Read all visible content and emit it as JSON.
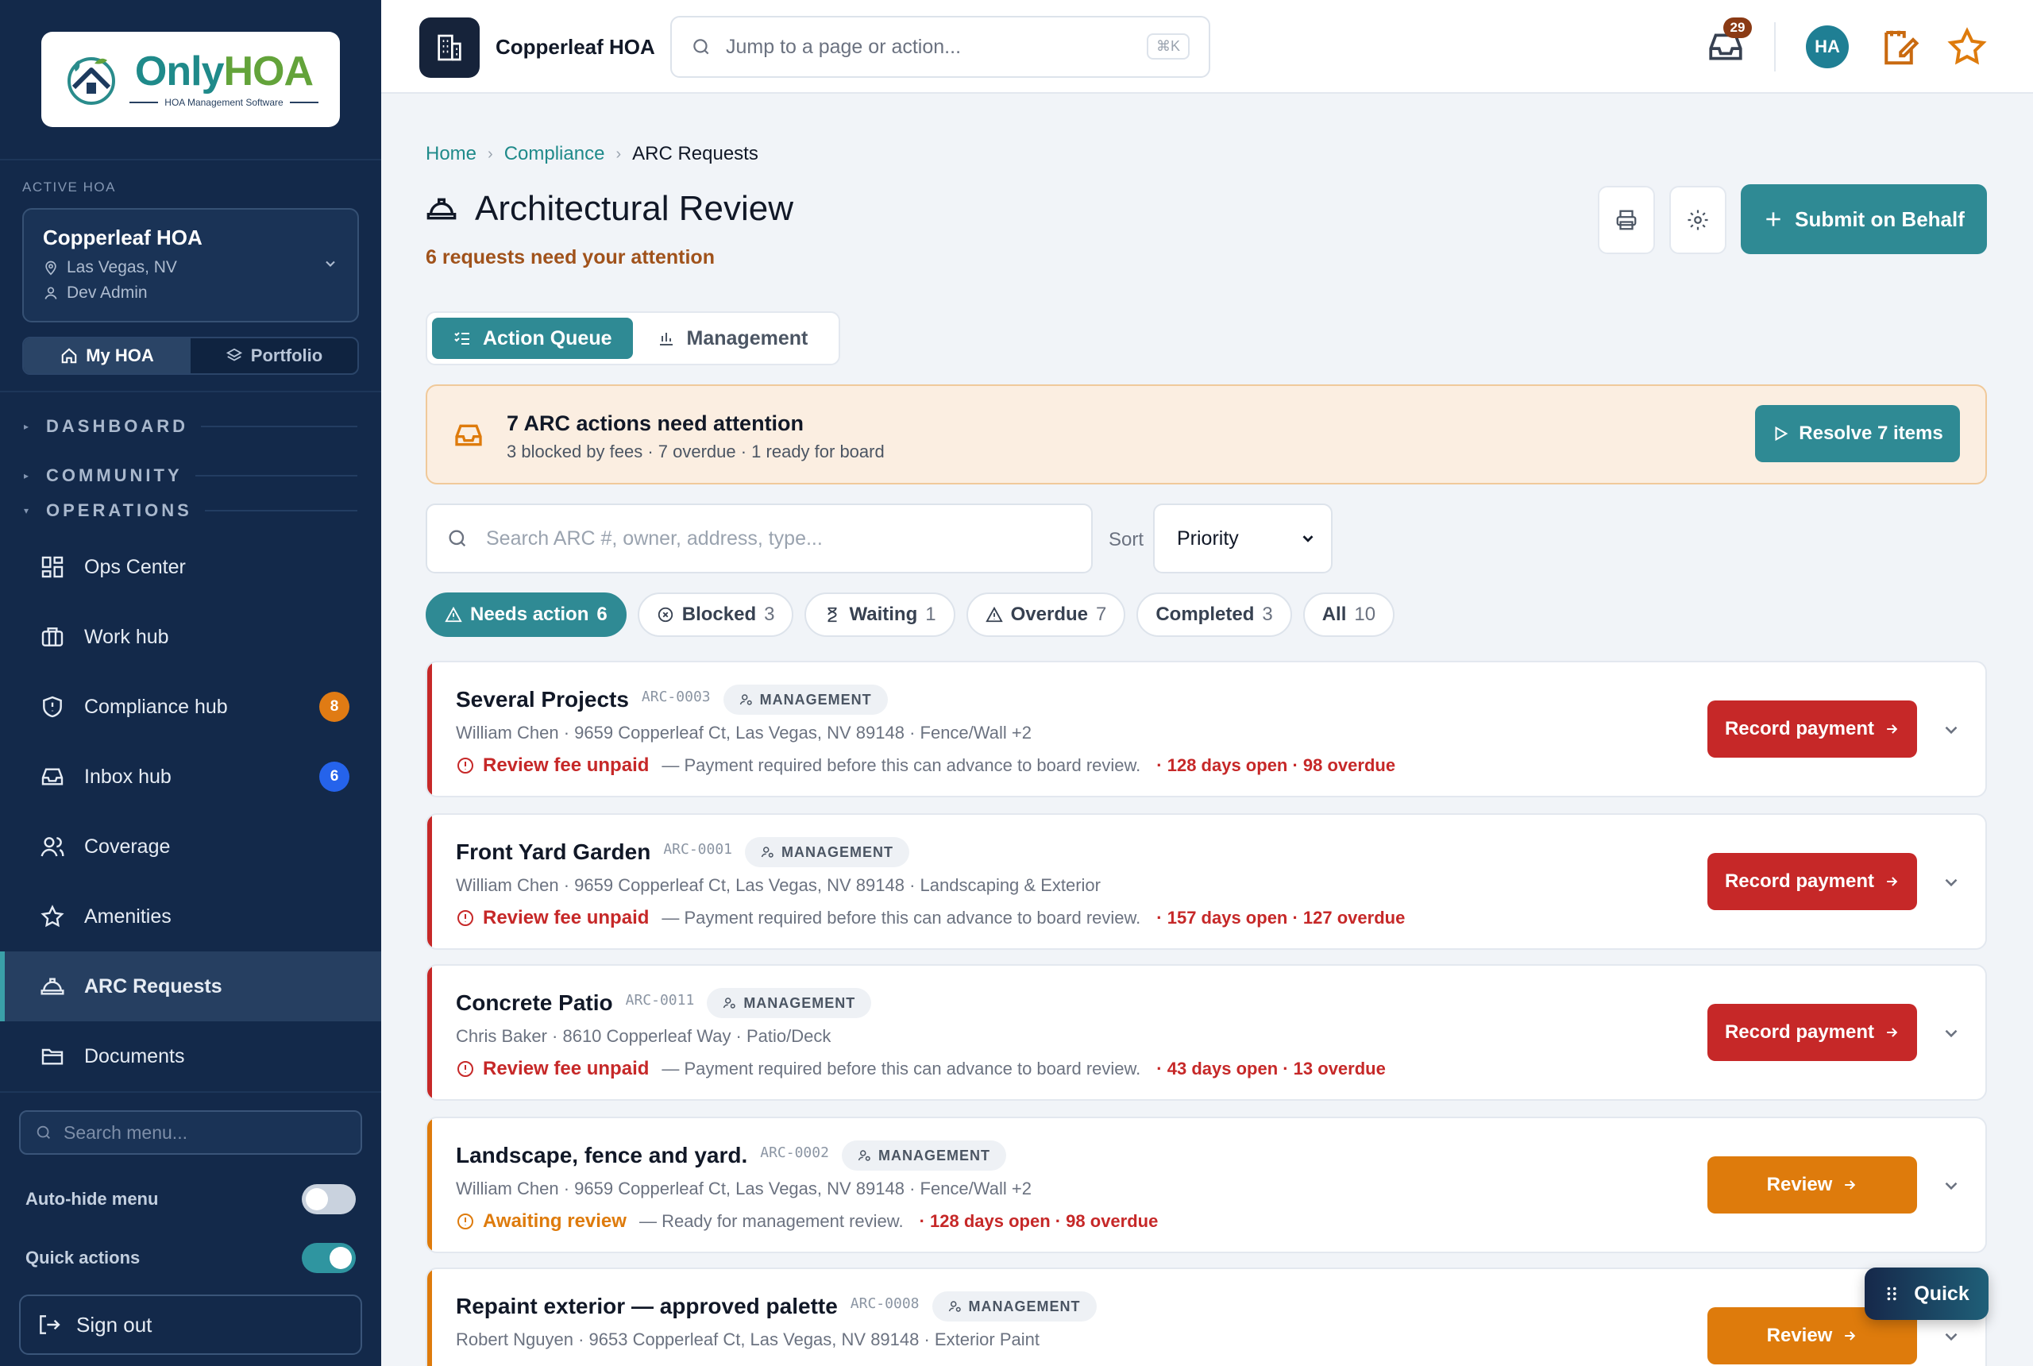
{
  "sidebar": {
    "logo": {
      "only": "Only",
      "hoa": "HOA",
      "tagline": "HOA Management Software"
    },
    "active_label": "ACTIVE HOA",
    "hoa": {
      "name": "Copperleaf HOA",
      "location": "Las Vegas, NV",
      "user": "Dev Admin"
    },
    "scope": {
      "my_hoa": "My HOA",
      "portfolio": "Portfolio"
    },
    "sections": {
      "dashboard": "DASHBOARD",
      "community": "COMMUNITY",
      "operations": "OPERATIONS"
    },
    "nav": [
      {
        "label": "Ops Center",
        "icon": "grid-icon"
      },
      {
        "label": "Work hub",
        "icon": "briefcase-icon"
      },
      {
        "label": "Compliance hub",
        "icon": "shield-icon",
        "badge": "8",
        "badge_color": "#e07b14"
      },
      {
        "label": "Inbox hub",
        "icon": "inbox-icon",
        "badge": "6",
        "badge_color": "#2563eb"
      },
      {
        "label": "Coverage",
        "icon": "users-icon"
      },
      {
        "label": "Amenities",
        "icon": "star-icon"
      },
      {
        "label": "ARC Requests",
        "icon": "hardhat-icon",
        "active": true
      },
      {
        "label": "Documents",
        "icon": "folder-icon"
      }
    ],
    "search_placeholder": "Search menu...",
    "auto_hide": {
      "label": "Auto-hide menu",
      "on": false
    },
    "quick_actions": {
      "label": "Quick actions",
      "on": true
    },
    "sign_out": "Sign out"
  },
  "topbar": {
    "title": "Copperleaf HOA",
    "search_placeholder": "Jump to a page or action...",
    "shortcut": "⌘K",
    "inbox_count": "29",
    "avatar": "HA"
  },
  "breadcrumb": {
    "home": "Home",
    "compliance": "Compliance",
    "current": "ARC Requests"
  },
  "page": {
    "title": "Architectural Review",
    "subtitle": "6 requests need your attention",
    "submit_label": "Submit on Behalf"
  },
  "tabs": {
    "queue": "Action Queue",
    "management": "Management"
  },
  "banner": {
    "title": "7 ARC actions need attention",
    "detail": "3 blocked by fees · 7 overdue · 1 ready for board",
    "button": "Resolve 7 items"
  },
  "search": {
    "placeholder": "Search ARC #, owner, address, type..."
  },
  "sort": {
    "label": "Sort",
    "value": "Priority"
  },
  "filters": [
    {
      "label": "Needs action",
      "count": "6",
      "icon": "alert-icon",
      "active": true
    },
    {
      "label": "Blocked",
      "count": "3",
      "icon": "x-circle-icon"
    },
    {
      "label": "Waiting",
      "count": "1",
      "icon": "hourglass-icon"
    },
    {
      "label": "Overdue",
      "count": "7",
      "icon": "alert-icon"
    },
    {
      "label": "Completed",
      "count": "3"
    },
    {
      "label": "All",
      "count": "10"
    }
  ],
  "requests": [
    {
      "title": "Several Projects",
      "id": "ARC-0003",
      "tag": "MANAGEMENT",
      "owner": "William Chen · 9659 Copperleaf Ct, Las Vegas, NV 89148 · Fence/Wall +2",
      "status": "Review fee unpaid",
      "note": "— Payment required before this can advance to board review.",
      "overdue": "· 128 days open · 98 overdue",
      "action": "Record payment",
      "tone": "red"
    },
    {
      "title": "Front Yard Garden",
      "id": "ARC-0001",
      "tag": "MANAGEMENT",
      "owner": "William Chen · 9659 Copperleaf Ct, Las Vegas, NV 89148 · Landscaping & Exterior",
      "status": "Review fee unpaid",
      "note": "— Payment required before this can advance to board review.",
      "overdue": "· 157 days open · 127 overdue",
      "action": "Record payment",
      "tone": "red"
    },
    {
      "title": "Concrete Patio",
      "id": "ARC-0011",
      "tag": "MANAGEMENT",
      "owner": "Chris Baker · 8610 Copperleaf Way · Patio/Deck",
      "status": "Review fee unpaid",
      "note": "— Payment required before this can advance to board review.",
      "overdue": "· 43 days open · 13 overdue",
      "action": "Record payment",
      "tone": "red"
    },
    {
      "title": "Landscape, fence and yard.",
      "id": "ARC-0002",
      "tag": "MANAGEMENT",
      "owner": "William Chen · 9659 Copperleaf Ct, Las Vegas, NV 89148 · Fence/Wall +2",
      "status": "Awaiting review",
      "note": "— Ready for management review.",
      "overdue": "· 128 days open · 98 overdue",
      "action": "Review",
      "tone": "amber"
    },
    {
      "title": "Repaint exterior — approved palette",
      "id": "ARC-0008",
      "tag": "MANAGEMENT",
      "owner": "Robert Nguyen · 9653 Copperleaf Ct, Las Vegas, NV 89148 · Exterior Paint",
      "status": "",
      "note": "",
      "overdue": "",
      "action": "Review",
      "tone": "amber"
    }
  ],
  "quick": "Quick",
  "colors": {
    "teal": "#2f8a94",
    "navy": "#13294a",
    "danger": "#c62828",
    "warning": "#de7b0c"
  }
}
